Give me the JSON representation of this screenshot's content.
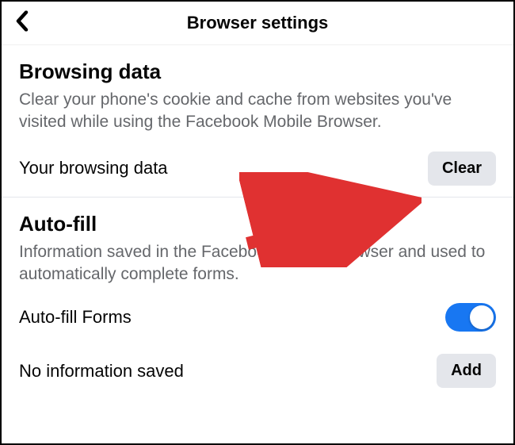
{
  "header": {
    "title": "Browser settings"
  },
  "browsingData": {
    "title": "Browsing data",
    "description": "Clear your phone's cookie and cache from websites you've visited while using the Facebook Mobile Browser.",
    "row_label": "Your browsing data",
    "clear_button": "Clear"
  },
  "autoFill": {
    "title": "Auto-fill",
    "description": "Information saved in the Facebook Mobile Browser and used to automatically complete forms.",
    "forms_label": "Auto-fill Forms",
    "forms_toggle_on": true,
    "no_info_label": "No information saved",
    "add_button": "Add"
  }
}
